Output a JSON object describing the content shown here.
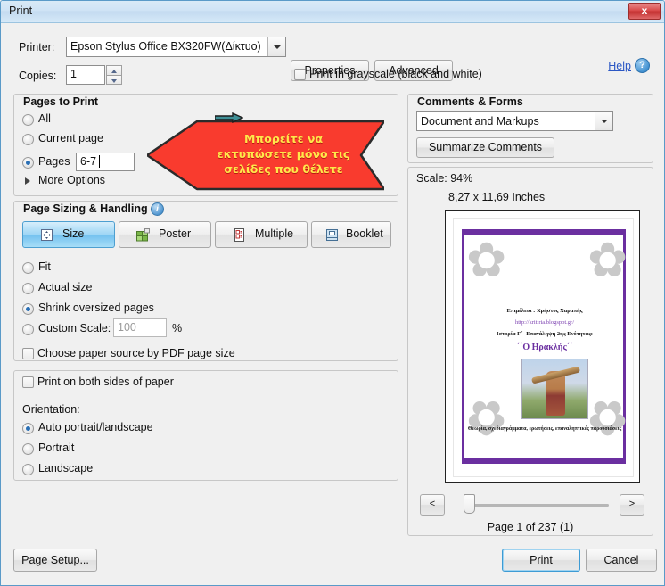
{
  "window": {
    "title": "Print",
    "close_label": "x"
  },
  "printer": {
    "label": "Printer:",
    "selected": "Epson Stylus Office BX320FW(Δίκτυο)",
    "properties_label": "Properties",
    "advanced_label": "Advanced",
    "copies_label": "Copies:",
    "copies_value": "1",
    "grayscale_label": "Print in grayscale (black and white)",
    "grayscale_checked": false,
    "help_label": "Help",
    "help_icon_glyph": "?"
  },
  "pages_to_print": {
    "title": "Pages to Print",
    "options": [
      {
        "label": "All",
        "selected": false
      },
      {
        "label": "Current page",
        "selected": false
      },
      {
        "label": "Pages",
        "selected": true
      }
    ],
    "pages_value": "6-7",
    "more_options_label": "More Options"
  },
  "page_sizing": {
    "title": "Page Sizing & Handling",
    "info_glyph": "i",
    "mode_buttons": [
      {
        "label": "Size",
        "icon": "size-icon",
        "active": true
      },
      {
        "label": "Poster",
        "icon": "poster-icon",
        "active": false
      },
      {
        "label": "Multiple",
        "icon": "multiple-icon",
        "active": false
      },
      {
        "label": "Booklet",
        "icon": "booklet-icon",
        "active": false
      }
    ],
    "scale_options": [
      {
        "label": "Fit",
        "selected": false
      },
      {
        "label": "Actual size",
        "selected": false
      },
      {
        "label": "Shrink oversized pages",
        "selected": true
      },
      {
        "label": "Custom Scale:",
        "selected": false
      }
    ],
    "custom_scale_value": "100",
    "custom_scale_unit": "%",
    "paper_source_label": "Choose paper source by PDF page size",
    "paper_source_checked": false
  },
  "duplex": {
    "both_sides_label": "Print on both sides of paper",
    "both_sides_checked": false,
    "orientation_label": "Orientation:",
    "orientation_options": [
      {
        "label": "Auto portrait/landscape",
        "selected": true
      },
      {
        "label": "Portrait",
        "selected": false
      },
      {
        "label": "Landscape",
        "selected": false
      }
    ]
  },
  "comments_forms": {
    "title": "Comments & Forms",
    "selected": "Document and Markups",
    "summarize_label": "Summarize Comments"
  },
  "preview": {
    "scale_text": "Scale:  94%",
    "size_text": "8,27 x 11,69 Inches",
    "page_indicator": "Page 1 of 237 (1)",
    "prev_label": "<",
    "next_label": ">",
    "document": {
      "author_line": "Επιμέλεια : Χρήστος Χαρμπής",
      "url_line": "http://kritiria.blogspot.gr/",
      "course_line": "Ιστορία Γ΄- Επανάληψη 2ης Ενότητας:",
      "title_line": "΄΄Ο Ηρακλής΄΄",
      "footer_line": "Θεωρία, σχεδιαγράμματα, ερωτήσεις, επαναληπτικές παρουσιάσεις"
    }
  },
  "annotation": {
    "text_lines": [
      "Μπορείτε να",
      "εκτυπώσετε μόνο τις",
      "σελίδες που θέλετε"
    ],
    "fill_color": "#f93b2e",
    "text_color": "#ffe84a"
  },
  "footer": {
    "page_setup_label": "Page Setup...",
    "print_label": "Print",
    "cancel_label": "Cancel"
  }
}
